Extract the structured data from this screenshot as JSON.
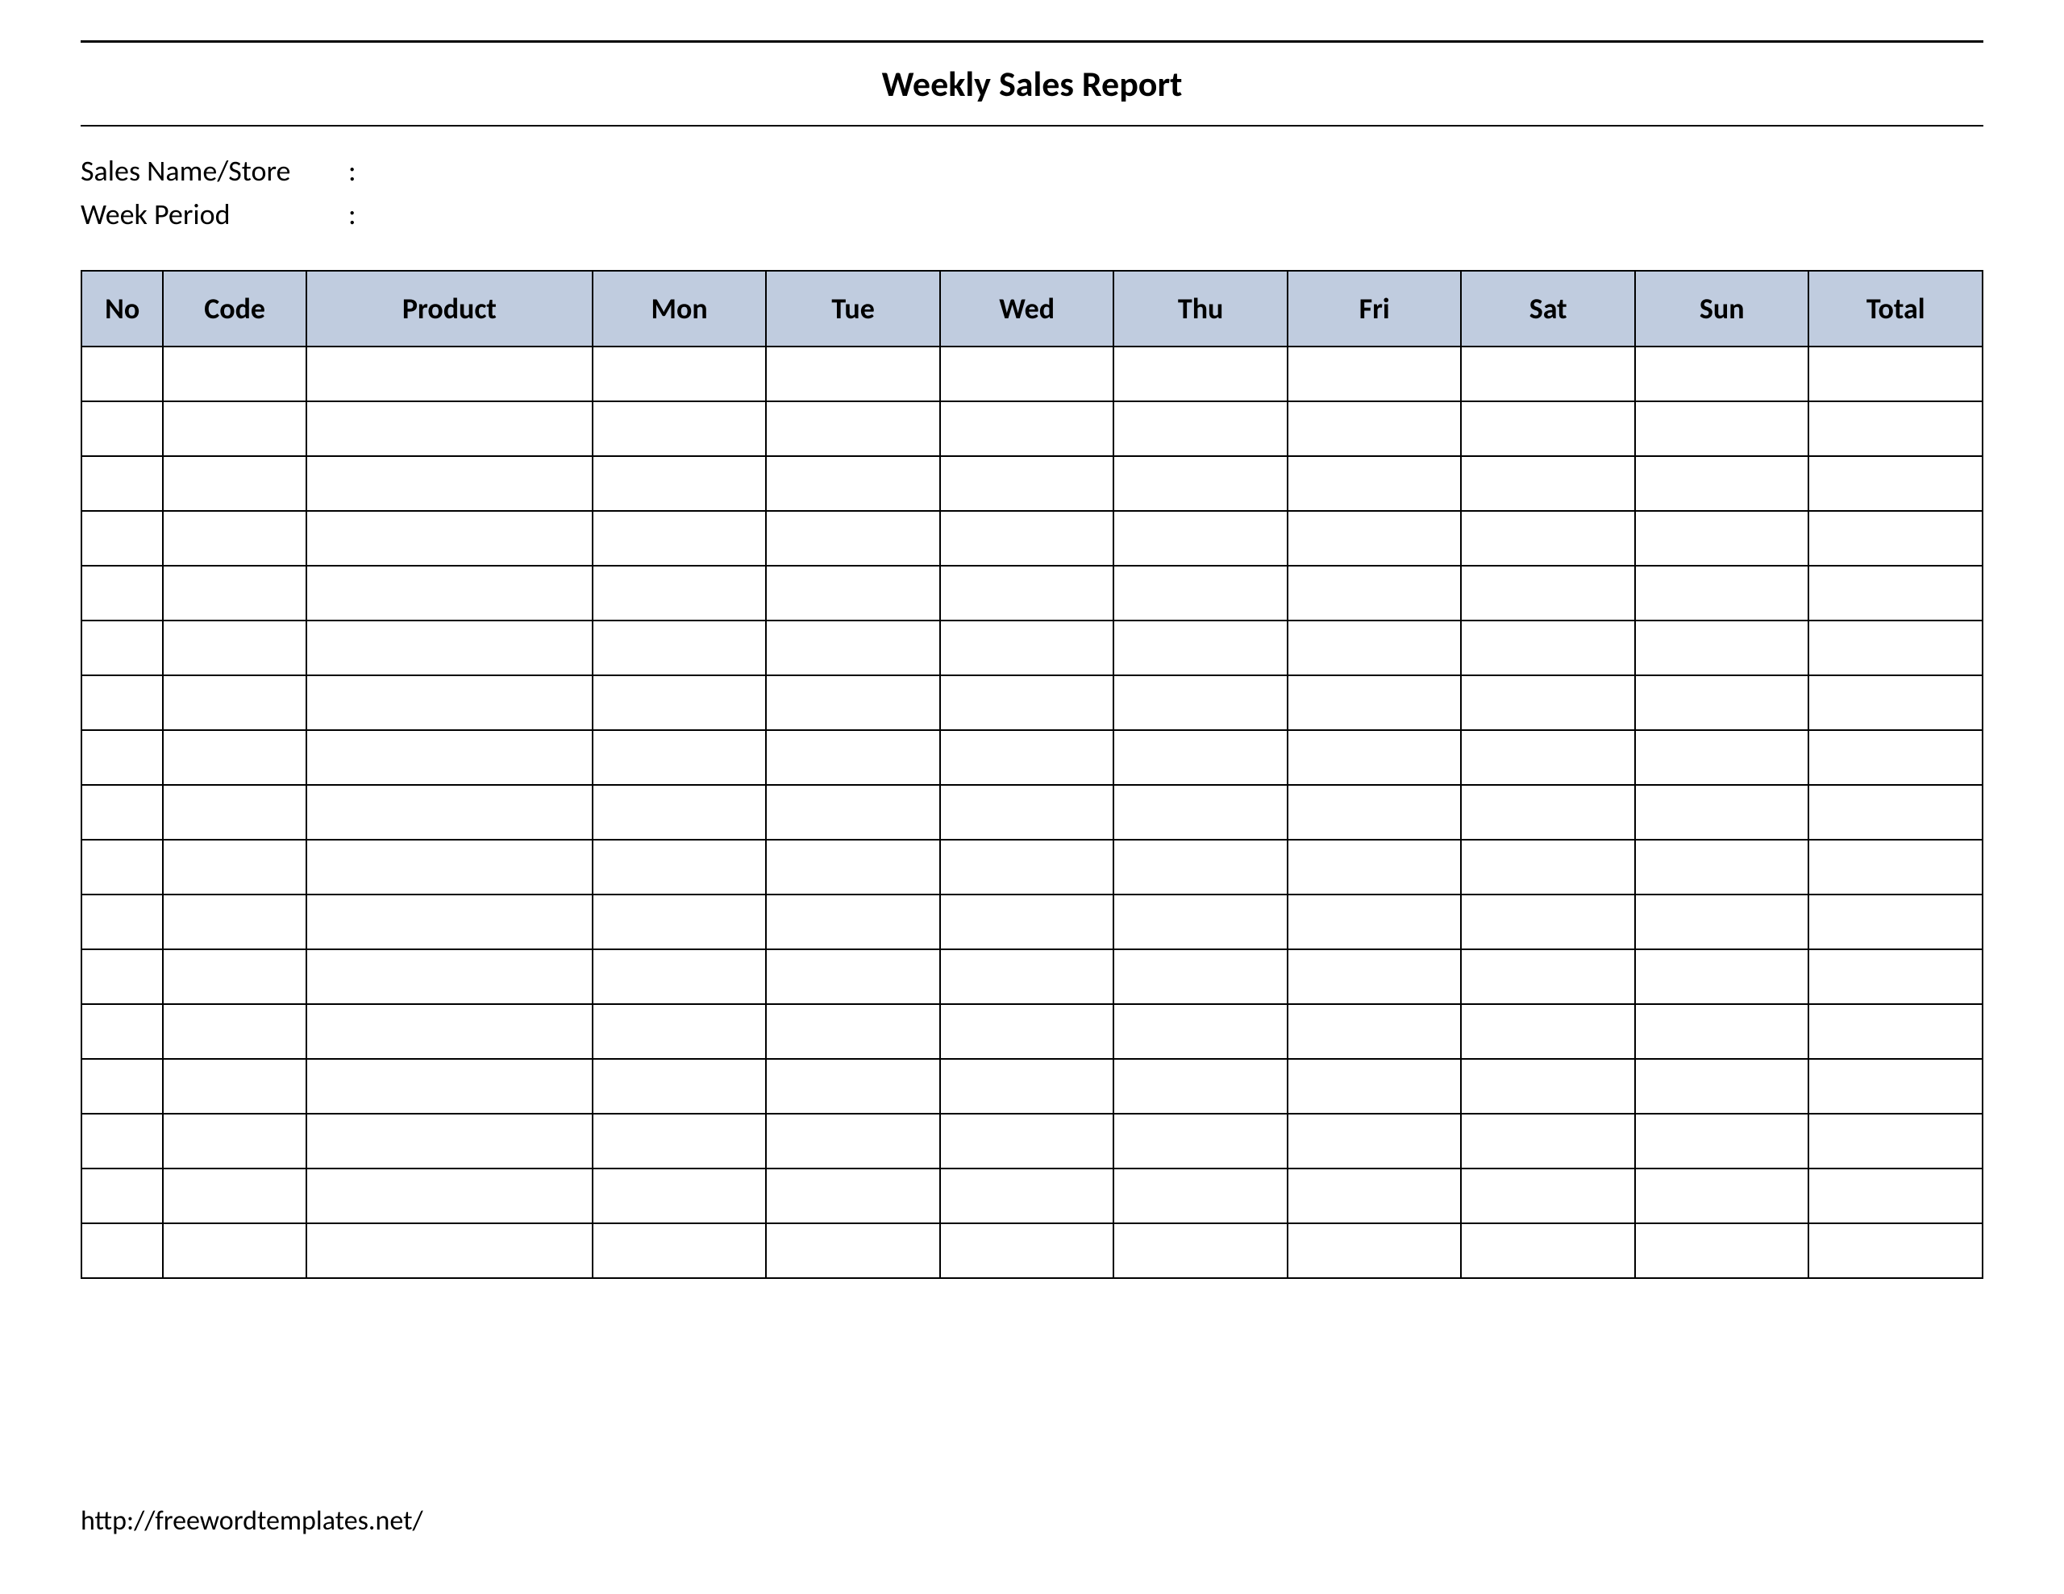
{
  "title": "Weekly Sales Report",
  "meta": {
    "sales_label": "Sales Name/Store",
    "period_label": "Week  Period",
    "colon": ":"
  },
  "columns": {
    "no": "No",
    "code": "Code",
    "product": "Product",
    "mon": "Mon",
    "tue": "Tue",
    "wed": "Wed",
    "thu": "Thu",
    "fri": "Fri",
    "sat": "Sat",
    "sun": "Sun",
    "total": "Total"
  },
  "row_count": 17,
  "footer": "http://freewordtemplates.net/"
}
